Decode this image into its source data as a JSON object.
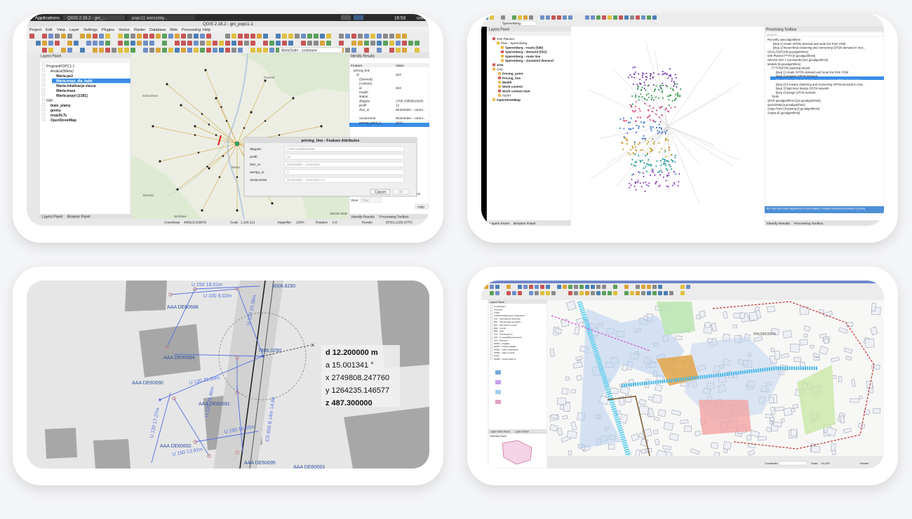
{
  "screens": {
    "qgis_tl": {
      "os_bar": {
        "apps": "Applications",
        "win1": "QGIS 2.18.2 - gni_...",
        "win2": "popc11 warsztaty...",
        "time": "16:53",
        "user": "user"
      },
      "window_title": "QGIS 2.18.2 - gni_popc1-1",
      "menu": [
        "Project",
        "Edit",
        "View",
        "Layer",
        "Settings",
        "Plugins",
        "Vector",
        "Raster",
        "Database",
        "Web",
        "Processing",
        "Help"
      ],
      "search_value": "WorkOrder - commune",
      "layers_panel_title": "Layers Panel",
      "layers": [
        "ProgramPOPC1.1",
        "Analiza(Warta)",
        "Warta-pe2",
        "Warta-trasa_dla_kabli",
        "Warta-lokalizacja zlacza",
        "Warta-trasa",
        "Warta-popyt [2181]",
        "GNI",
        "biale_plamy",
        "gminy",
        "mojeDLTy",
        "OpenStreetMap"
      ],
      "panel_tabs": [
        "Layers Panel",
        "Browser Panel"
      ],
      "identify": {
        "title": "Identify Results",
        "cols": [
          "Feature",
          "Value"
        ],
        "rows": [
          [
            "pricing_line",
            ""
          ],
          [
            "id",
            "319"
          ],
          [
            "(Derived)",
            ""
          ],
          [
            "(Actions)",
            ""
          ],
          [
            "id",
            "319"
          ],
          [
            "model",
            ""
          ],
          [
            "status",
            ""
          ],
          [
            "dlugosc",
            "1708.10865915205"
          ],
          [
            "profil",
            "12"
          ],
          [
            "zlec_nr",
            "WorkOrder - comm..."
          ],
          [
            "wersja_nr",
            "1"
          ],
          [
            "oznaczenie",
            "WorkOrder - comm..."
          ],
          [
            "pricing_point_f...",
            "1071"
          ]
        ],
        "mode_label": "Mode",
        "mode_value": "Current layer",
        "auto_open": "Auto open form",
        "view_label": "View",
        "view_value": "Tree",
        "help": "Help",
        "tabs": [
          "Identify Results",
          "Processing Toolbox"
        ]
      },
      "dialog": {
        "title": "pricing_line - Feature Attributes",
        "fields": [
          {
            "label": "dlugosc",
            "value": "1708.10865915205"
          },
          {
            "label": "profil",
            "value": "12"
          },
          {
            "label": "zlec_nr",
            "value": "WorkOrder - commune"
          },
          {
            "label": "wersja_nr",
            "value": "1"
          },
          {
            "label": "oznaczenie",
            "value": "WorkOrder - commune-v-1"
          }
        ],
        "cancel": "Cancel",
        "ok": "OK"
      },
      "places": [
        "Poznań",
        "Goluszewo",
        "Warta",
        "Brzezki",
        "Wróblew",
        "Złotniki Małe"
      ],
      "status": {
        "coord_label": "Coordinate",
        "coord": "485023,539879",
        "scale_label": "Scale",
        "scale": "1:109 212",
        "magnifier_label": "Magnifier",
        "magnifier": "100%",
        "rotation_label": "Rotation",
        "rotation": "0.0",
        "render": "Render",
        "epsg": "EPSG:2180 (OTF)"
      }
    },
    "qgis_tr": {
      "search_value": "Sperenberg",
      "layers_panel_title": "Layers Panel",
      "layers": [
        "GNI Planner",
        "Plan - Sperenberg",
        "Sperenberg - roads [589]",
        "Sperenberg - demand [591]",
        "Sperenberg - route line",
        "Sperenberg - clustered demand",
        "area",
        "GNI",
        "Pricing_point",
        "Pricing_line",
        "Model",
        "Work context",
        "Work context item",
        "report",
        "OpenStreetMap"
      ],
      "panel_tabs": [
        "Layers Panel",
        "Browser Panel"
      ],
      "toolbox": {
        "title": "Processing Toolbox",
        "search": "Search...",
        "items": [
          "Recently used algorithms",
          "[step 1] create GPON demand and route line from OSM",
          "[step 2] hierarchical clustering and connecting GPON demand to rout...",
          "GDAL/OGR [48 geoalgorithms]",
          "GNI Planner FTTH [8 geoalgorithms]",
          "GRASS GIS 7 commands [314 geoalgorithms]",
          "Models [6 geoalgorithms]",
          "FTTH/GPON planning wizard",
          "[step 1] create GPON demand and route line from OSM",
          "[step 1] prepare GPON demand",
          "[step 2] hierarchical clustering and connecting GPON demand to r...",
          "[step 2] K-means clustering and connecting GPON demand to rout...",
          "[step 3] high level design GPON network",
          "[step 4] design GPON network",
          "Tools",
          "QGIS geoalgorithms [110 geoalgorithms]",
          "QuickOSM [5 geoalgorithms]",
          "Scipy Point Clustering [3 geoalgorithms]",
          "Scripts [6 geoalgorithms]"
        ],
        "notice": "You can add more algorithms to the toolbox, enable additional providers. [close]",
        "tabs": [
          "Identify Results",
          "Processing Toolbox"
        ]
      }
    },
    "measure_bl": {
      "readout": {
        "d": "d 12.200000 m",
        "a": "a 15.001341 °",
        "x": "x 2749808.247760",
        "y": "y 1264235.146577",
        "z": "z 487.300000"
      },
      "labels": [
        "U 150 18.01m",
        "U 100 9.02m",
        "U 120 10.38m",
        "U 120 29.00m",
        "U 150 16.65m",
        "U 150 13.91m",
        "U 120 17.27m",
        "U 120 29.46m",
        "AAA DE60688",
        "AAA DE60684",
        "AAA DE60690",
        "AAA DE60691",
        "AAA DE60692",
        "AAA DE60693",
        "AAA DE60695",
        "8008.8290",
        "7886.0290",
        "CS 600 8.14m 14.88"
      ]
    },
    "qgis_br": {
      "layers_panel_title": "Layers Panel",
      "panel_tabs": [
        "Layer Order Panel",
        "Layers Panel"
      ],
      "overview_title": "Overview Panel",
      "layer_items": [
        "Confinazioni",
        "Toponimi",
        "CTR5",
        "C1109 Pianificazione Urbanistica",
        "A01 - Informazioni territoriali",
        "B01 - Vincoli della normativa",
        "B01 - Elementi di vincolo",
        "B02 - Vincoli",
        "B03 - Aree",
        "C01 - Pianificazione",
        "D01 - Compatibilita geologica",
        "D02 - Elementi",
        "N0301 - Fragilita",
        "N0401 - Trasformabilita",
        "N0501 - Azioni strategiche",
        "N0601 - Valori e tutele",
        "PTRC",
        "N0300 - Trasformazioni"
      ],
      "places": [
        "PRUDMONTE"
      ],
      "status": {
        "coord_label": "Coordinate",
        "scale_label": "Scale",
        "scale": "1:5,000",
        "render": "Render"
      }
    }
  }
}
